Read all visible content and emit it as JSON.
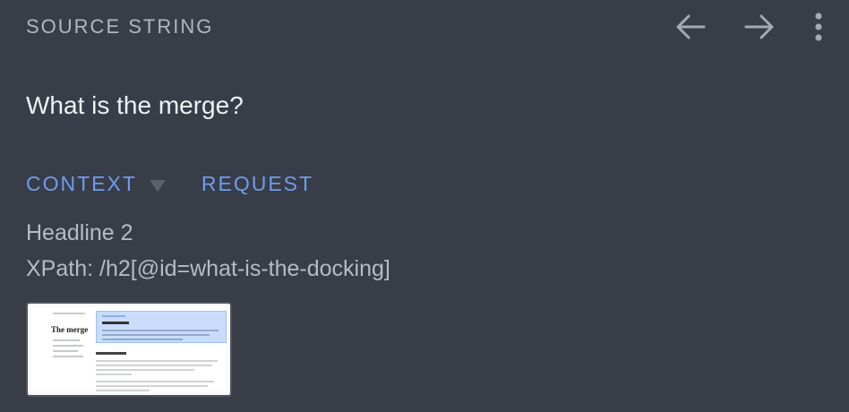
{
  "header": {
    "label": "SOURCE STRING"
  },
  "toolbar": {
    "prev": {
      "icon": "arrow-left-icon"
    },
    "next": {
      "icon": "arrow-right-icon"
    },
    "more": {
      "icon": "more-vertical-icon"
    }
  },
  "source": {
    "text": "What is the merge?"
  },
  "tabs": [
    {
      "label": "CONTEXT",
      "has_dropdown": true
    },
    {
      "label": "REQUEST",
      "has_dropdown": false
    }
  ],
  "context": {
    "element_type": "Headline 2",
    "xpath": "XPath: /h2[@id=what-is-the-docking]"
  },
  "screenshot_thumbnail": {
    "heading_text": "The merge"
  },
  "colors": {
    "background": "#393d48",
    "tab_accent": "#6e9cf0",
    "muted_text": "#b8bbc2"
  }
}
